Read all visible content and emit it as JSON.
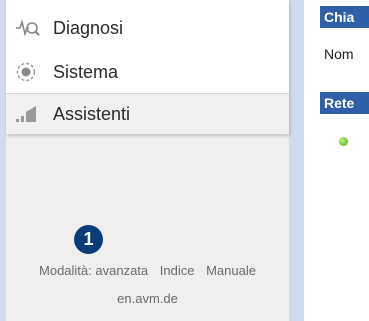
{
  "sidebar": {
    "items": [
      {
        "label": "Diagnosi",
        "icon": "diagnostics-icon"
      },
      {
        "label": "Sistema",
        "icon": "system-icon"
      },
      {
        "label": "Assistenti",
        "icon": "assistants-icon"
      }
    ],
    "badge": "1",
    "footer": {
      "mode": "Modalità: avanzata",
      "index": "Indice",
      "manual": "Manuale",
      "domain": "en.avm.de"
    }
  },
  "main": {
    "section1_title": "Chia",
    "section1_text": "Nom",
    "section2_title": "Rete"
  },
  "colors": {
    "accent": "#2f5fa8",
    "badge": "#0b3c78",
    "status_ok": "#4fa818"
  }
}
